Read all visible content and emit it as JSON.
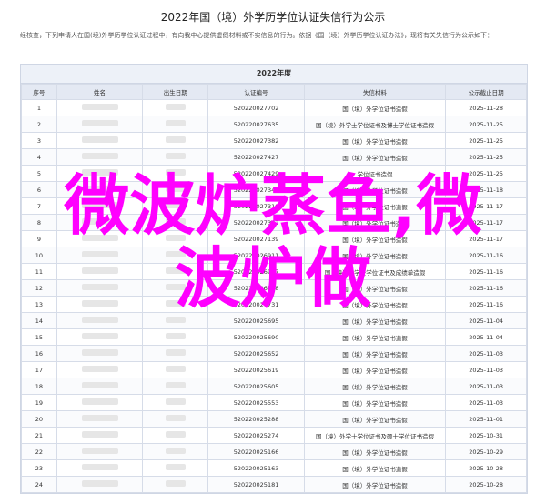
{
  "document": {
    "title": "2022年国（境）外学历学位认证失信行为公示",
    "intro": "经核查，下列申请人在国(境)外学历学位认证过程中，有向我中心提供虚假材料或不实信息的行为。依据《国（境）外学历学位认证办法》，现将有关失信行为公示如下："
  },
  "table": {
    "title": "2022年度",
    "headers": [
      "序号",
      "姓名",
      "出生日期",
      "认证编号",
      "失信材料",
      "公示截止日期"
    ],
    "rows": [
      {
        "no": "1",
        "id": "520220027702",
        "material": "国（境）外学位证书造假",
        "date": "2025-11-28"
      },
      {
        "no": "2",
        "id": "520220027635",
        "material": "国（境）外学士学位证书及博士学位证书造假",
        "date": "2025-11-25"
      },
      {
        "no": "3",
        "id": "520220027382",
        "material": "国（境）外学位证书造假",
        "date": "2025-11-25"
      },
      {
        "no": "4",
        "id": "520220027427",
        "material": "国（境）外学位证书造假",
        "date": "2025-11-25"
      },
      {
        "no": "5",
        "id": "520220027429",
        "material": "学位证书造假",
        "date": "2025-11-25"
      },
      {
        "no": "6",
        "id": "520220027341",
        "material": "国（境）外学位证书造假",
        "date": "2025-11-18"
      },
      {
        "no": "7",
        "id": "520220027318",
        "material": "国（境）外学位证书造假",
        "date": "2025-11-17"
      },
      {
        "no": "8",
        "id": "520220027302",
        "material": "国（境）外学位证书造假",
        "date": "2025-11-17"
      },
      {
        "no": "9",
        "id": "520220027139",
        "material": "国（境）外学位证书造假",
        "date": "2025-11-17"
      },
      {
        "no": "10",
        "id": "520220026911",
        "material": "国（境）外学位证书造假",
        "date": "2025-11-16"
      },
      {
        "no": "11",
        "id": "520220026907",
        "material": "国（境）外学士学位证书及成绩单造假",
        "date": "2025-11-16"
      },
      {
        "no": "12",
        "id": "520220026788",
        "material": "国（境）外学位证书造假",
        "date": "2025-11-16"
      },
      {
        "no": "13",
        "id": "520220026731",
        "material": "国（境）外学位证书造假",
        "date": "2025-11-16"
      },
      {
        "no": "14",
        "id": "520220025695",
        "material": "国（境）外学位证书造假",
        "date": "2025-11-04"
      },
      {
        "no": "15",
        "id": "520220025690",
        "material": "国（境）外学位证书造假",
        "date": "2025-11-04"
      },
      {
        "no": "16",
        "id": "520220025652",
        "material": "国（境）外学位证书造假",
        "date": "2025-11-03"
      },
      {
        "no": "17",
        "id": "520220025619",
        "material": "国（境）外学位证书造假",
        "date": "2025-11-03"
      },
      {
        "no": "18",
        "id": "520220025605",
        "material": "国（境）外学位证书造假",
        "date": "2025-11-03"
      },
      {
        "no": "19",
        "id": "520220025553",
        "material": "国（境）外学位证书造假",
        "date": "2025-11-03"
      },
      {
        "no": "20",
        "id": "520220025288",
        "material": "国（境）外学位证书造假",
        "date": "2025-11-01"
      },
      {
        "no": "21",
        "id": "520220025274",
        "material": "国（境）外学士学位证书及硕士学位证书造假",
        "date": "2025-10-31"
      },
      {
        "no": "22",
        "id": "520220025166",
        "material": "国（境）外学位证书造假",
        "date": "2025-10-29"
      },
      {
        "no": "23",
        "id": "520220025163",
        "material": "国（境）外学位证书造假",
        "date": "2025-10-28"
      },
      {
        "no": "24",
        "id": "520220025181",
        "material": "国（境）外学位证书造假",
        "date": "2025-10-28"
      }
    ]
  },
  "overlay": {
    "line1": "微波炉蒸鱼,微",
    "line2": "波炉做",
    "color": "#ff00ff"
  }
}
